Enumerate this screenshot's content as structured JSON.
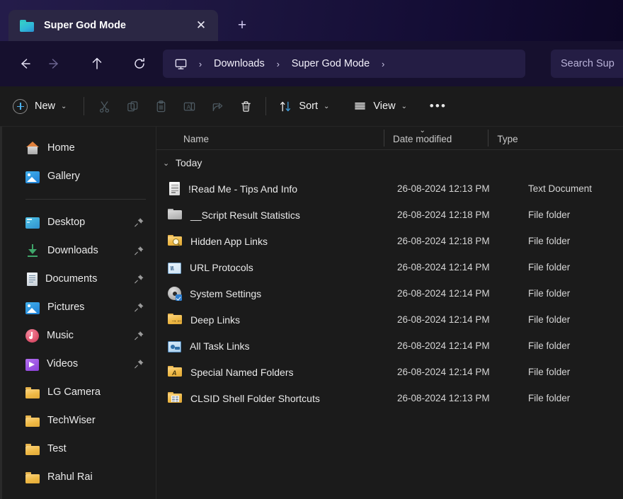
{
  "window": {
    "tab": {
      "title": "Super God Mode",
      "icon": "folder-icon",
      "close_label": "✕"
    },
    "new_tab_label": "+"
  },
  "address_bar": {
    "back_label": "back-arrow",
    "forward_label": "forward-arrow",
    "up_label": "up-arrow",
    "refresh_label": "refresh",
    "breadcrumb": {
      "root_icon": "this-pc-icon",
      "separator": "›",
      "items": [
        "Downloads",
        "Super God Mode"
      ]
    },
    "search": {
      "placeholder": "Search Sup",
      "value": ""
    }
  },
  "toolbar": {
    "new_label": "New",
    "new_chevron": "⌄",
    "cut_label": "cut-icon",
    "copy_label": "copy-icon",
    "paste_label": "paste-icon",
    "rename_label": "rename-icon",
    "share_label": "share-icon",
    "delete_label": "delete-icon",
    "sort_label": "Sort",
    "sort_chevron": "⌄",
    "view_label": "View",
    "view_chevron": "⌄",
    "more_label": "•••"
  },
  "sidebar": {
    "items": [
      {
        "label": "Home",
        "icon": "home-icon",
        "pinned": false
      },
      {
        "label": "Gallery",
        "icon": "gallery-icon",
        "pinned": false
      },
      {
        "label": "Desktop",
        "icon": "desktop-icon",
        "pinned": true
      },
      {
        "label": "Downloads",
        "icon": "downloads-icon",
        "pinned": true
      },
      {
        "label": "Documents",
        "icon": "documents-icon",
        "pinned": true
      },
      {
        "label": "Pictures",
        "icon": "pictures-icon",
        "pinned": true
      },
      {
        "label": "Music",
        "icon": "music-icon",
        "pinned": true
      },
      {
        "label": "Videos",
        "icon": "videos-icon",
        "pinned": true
      },
      {
        "label": "LG Camera",
        "icon": "folder-icon",
        "pinned": false
      },
      {
        "label": "TechWiser",
        "icon": "folder-icon",
        "pinned": false
      },
      {
        "label": "Test",
        "icon": "folder-icon",
        "pinned": false
      },
      {
        "label": "Rahul Rai",
        "icon": "folder-icon",
        "pinned": false
      }
    ]
  },
  "file_list": {
    "columns": [
      {
        "label": "Name",
        "sorted": false
      },
      {
        "label": "Date modified",
        "sorted": true,
        "direction": "descending"
      },
      {
        "label": "Type",
        "sorted": false
      }
    ],
    "group": {
      "label": "Today",
      "expanded": true,
      "chevron": "⌄"
    },
    "rows": [
      {
        "name": "!Read Me - Tips And Info",
        "icon": "text-file-icon",
        "date": "26-08-2024 12:13 PM",
        "type": "Text Document"
      },
      {
        "name": "__Script Result Statistics",
        "icon": "gray-folder-icon",
        "date": "26-08-2024 12:18 PM",
        "type": "File folder"
      },
      {
        "name": "Hidden App Links",
        "icon": "folder-search-icon",
        "date": "26-08-2024 12:18 PM",
        "type": "File folder"
      },
      {
        "name": "URL Protocols",
        "icon": "url-folder-icon",
        "date": "26-08-2024 12:14 PM",
        "type": "File folder"
      },
      {
        "name": "System Settings",
        "icon": "gear-settings-icon",
        "date": "26-08-2024 12:14 PM",
        "type": "File folder"
      },
      {
        "name": "Deep Links",
        "icon": "folder-arrows-icon",
        "date": "26-08-2024 12:14 PM",
        "type": "File folder"
      },
      {
        "name": "All Task Links",
        "icon": "task-links-icon",
        "date": "26-08-2024 12:14 PM",
        "type": "File folder"
      },
      {
        "name": "Special Named Folders",
        "icon": "folder-letter-a-icon",
        "date": "26-08-2024 12:14 PM",
        "type": "File folder"
      },
      {
        "name": "CLSID Shell Folder Shortcuts",
        "icon": "folder-grid-icon",
        "date": "26-08-2024 12:13 PM",
        "type": "File folder"
      }
    ]
  },
  "colors": {
    "titlebar_start": "#241c4a",
    "titlebar_end": "#0d0726",
    "tab_active": "#2b2744",
    "addressbar": "#16102e",
    "crumb_pill": "#241d44",
    "app_background": "#1b1b1b",
    "accent_blue": "#4cb1ef",
    "folder_yellow": "#efb945"
  }
}
